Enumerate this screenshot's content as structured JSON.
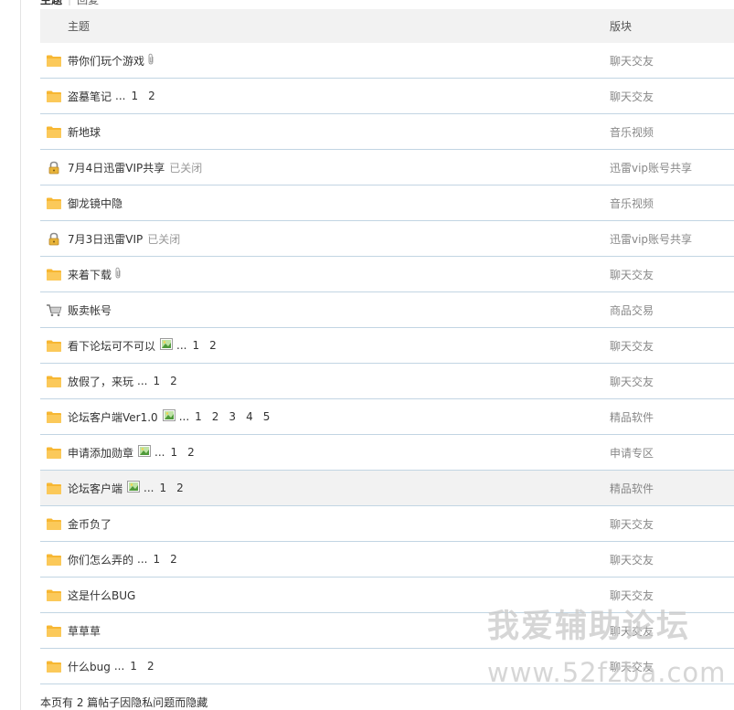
{
  "tabs": {
    "active": "主题",
    "other": "回复"
  },
  "table": {
    "headers": {
      "topic": "主题",
      "board": "版块"
    },
    "rows": [
      {
        "icon": "folder-icon",
        "title": "带你们玩个游戏",
        "attach": true,
        "image": false,
        "closed": "",
        "ellipsis": "",
        "pages": [],
        "board": "聊天交友"
      },
      {
        "icon": "folder-icon",
        "title": "盗墓笔记",
        "attach": false,
        "image": false,
        "closed": "",
        "ellipsis": "...",
        "pages": [
          "1",
          "2"
        ],
        "board": "聊天交友"
      },
      {
        "icon": "folder-icon",
        "title": "新地球",
        "attach": false,
        "image": false,
        "closed": "",
        "ellipsis": "",
        "pages": [],
        "board": "音乐视频"
      },
      {
        "icon": "lock-icon",
        "title": "7月4日迅雷VIP共享",
        "attach": false,
        "image": false,
        "closed": "已关闭",
        "ellipsis": "",
        "pages": [],
        "board": "迅雷vip账号共享"
      },
      {
        "icon": "folder-icon",
        "title": "御龙镜中隐",
        "attach": false,
        "image": false,
        "closed": "",
        "ellipsis": "",
        "pages": [],
        "board": "音乐视频"
      },
      {
        "icon": "lock-icon",
        "title": "7月3日迅雷VIP",
        "attach": false,
        "image": false,
        "closed": "已关闭",
        "ellipsis": "",
        "pages": [],
        "board": "迅雷vip账号共享"
      },
      {
        "icon": "folder-icon",
        "title": "来着下载",
        "attach": true,
        "image": false,
        "closed": "",
        "ellipsis": "",
        "pages": [],
        "board": "聊天交友"
      },
      {
        "icon": "cart-icon",
        "title": "贩卖帐号",
        "attach": false,
        "image": false,
        "closed": "",
        "ellipsis": "",
        "pages": [],
        "board": "商品交易"
      },
      {
        "icon": "folder-icon",
        "title": "看下论坛可不可以",
        "attach": false,
        "image": true,
        "closed": "",
        "ellipsis": "...",
        "pages": [
          "1",
          "2"
        ],
        "board": "聊天交友"
      },
      {
        "icon": "folder-icon",
        "title": "放假了，来玩",
        "attach": false,
        "image": false,
        "closed": "",
        "ellipsis": "...",
        "pages": [
          "1",
          "2"
        ],
        "board": "聊天交友"
      },
      {
        "icon": "folder-icon",
        "title": "论坛客户端Ver1.0",
        "attach": false,
        "image": true,
        "closed": "",
        "ellipsis": "...",
        "pages": [
          "1",
          "2",
          "3",
          "4",
          "5"
        ],
        "board": "精品软件"
      },
      {
        "icon": "folder-icon",
        "title": "申请添加勋章",
        "attach": false,
        "image": true,
        "closed": "",
        "ellipsis": "...",
        "pages": [
          "1",
          "2"
        ],
        "board": "申请专区"
      },
      {
        "icon": "folder-icon",
        "title": "论坛客户端",
        "attach": false,
        "image": true,
        "closed": "",
        "ellipsis": "...",
        "pages": [
          "1",
          "2"
        ],
        "board": "精品软件",
        "highlight": true
      },
      {
        "icon": "folder-icon",
        "title": "金币负了",
        "attach": false,
        "image": false,
        "closed": "",
        "ellipsis": "",
        "pages": [],
        "board": "聊天交友"
      },
      {
        "icon": "folder-icon",
        "title": "你们怎么弄的",
        "attach": false,
        "image": false,
        "closed": "",
        "ellipsis": "...",
        "pages": [
          "1",
          "2"
        ],
        "board": "聊天交友"
      },
      {
        "icon": "folder-icon",
        "title": "这是什么BUG",
        "attach": false,
        "image": false,
        "closed": "",
        "ellipsis": "",
        "pages": [],
        "board": "聊天交友"
      },
      {
        "icon": "folder-icon",
        "title": "草草草",
        "attach": false,
        "image": false,
        "closed": "",
        "ellipsis": "",
        "pages": [],
        "board": "聊天交友"
      },
      {
        "icon": "folder-icon",
        "title": "什么bug",
        "attach": false,
        "image": false,
        "closed": "",
        "ellipsis": "...",
        "pages": [
          "1",
          "2"
        ],
        "board": "聊天交友"
      }
    ]
  },
  "footer": {
    "note": "本页有 2 篇帖子因隐私问题而隐藏"
  },
  "watermark": {
    "title": "我爱辅助论坛",
    "url": "www.52fzba.com"
  },
  "colors": {
    "folder": "#f7b733",
    "row_border": "#c2d5e3",
    "header_bg": "#f2f2f2"
  }
}
